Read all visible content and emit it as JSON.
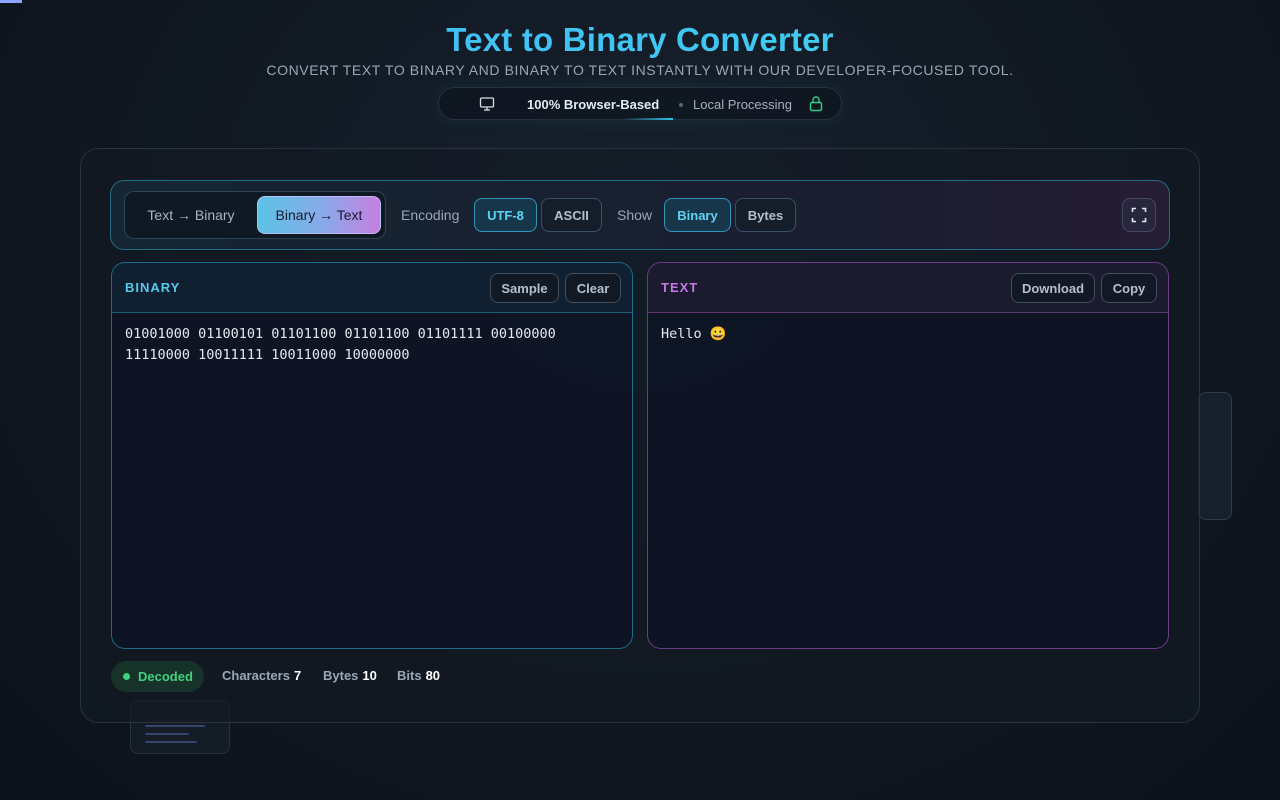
{
  "header": {
    "title": "Text to Binary Converter",
    "subtitle": "Convert text to binary and binary to text instantly with our developer-focused tool.",
    "badge_primary": "100% Browser-Based",
    "badge_secondary": "Local Processing",
    "badge_icons": [
      "monitor-icon",
      "lock-icon"
    ]
  },
  "toolbar": {
    "modes": [
      "Text → Binary",
      "Binary → Text"
    ],
    "active_mode": "Binary → Text",
    "encoding_label": "Encoding",
    "encodings": [
      "UTF-8",
      "ASCII"
    ],
    "active_encoding": "UTF-8",
    "show_label": "Show",
    "show_options": [
      "Binary",
      "Bytes"
    ],
    "active_show": "Binary",
    "fullscreen_icon": "expand-icon"
  },
  "binary_pane": {
    "title": "BINARY",
    "sample_label": "Sample",
    "clear_label": "Clear",
    "content": "01001000 01100101 01101100 01101100 01101111 00100000\n11110000 10011111 10011000 10000000"
  },
  "text_pane": {
    "title": "TEXT",
    "download_label": "Download",
    "copy_label": "Copy",
    "content": "Hello 😀"
  },
  "status": {
    "label": "Decoded",
    "characters_label": "Characters",
    "characters": "7",
    "bytes_label": "Bytes",
    "bytes": "10",
    "bits_label": "Bits",
    "bits": "80"
  },
  "colors": {
    "accent_cyan": "#3fc8f0",
    "accent_purple": "#c27ae6",
    "success_green": "#42cf7e"
  }
}
